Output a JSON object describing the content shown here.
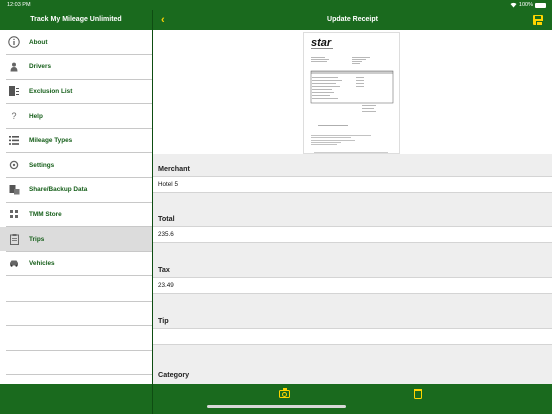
{
  "status_bar": {
    "time": "12:03 PM",
    "battery": "100%"
  },
  "sidebar": {
    "title": "Track My Mileage Unlimited",
    "items": [
      {
        "label": "About",
        "icon": "info-icon"
      },
      {
        "label": "Drivers",
        "icon": "person-icon"
      },
      {
        "label": "Exclusion List",
        "icon": "exclusion-list-icon"
      },
      {
        "label": "Help",
        "icon": "question-icon"
      },
      {
        "label": "Mileage Types",
        "icon": "list-icon"
      },
      {
        "label": "Settings",
        "icon": "gear-icon"
      },
      {
        "label": "Share/Backup Data",
        "icon": "share-backup-icon"
      },
      {
        "label": "TMM Store",
        "icon": "store-icon"
      },
      {
        "label": "Trips",
        "icon": "clipboard-icon",
        "selected": true
      },
      {
        "label": "Vehicles",
        "icon": "car-icon"
      }
    ]
  },
  "header": {
    "title": "Update Receipt"
  },
  "receipt": {
    "brand": "star"
  },
  "form": {
    "merchant": {
      "label": "Merchant",
      "value": "Hotel 5"
    },
    "total": {
      "label": "Total",
      "value": "235.6"
    },
    "tax": {
      "label": "Tax",
      "value": "23.49"
    },
    "tip": {
      "label": "Tip",
      "value": ""
    },
    "category": {
      "label": "Category"
    }
  },
  "colors": {
    "brand_green": "#1a6a1e",
    "accent_yellow": "#ffd400",
    "label_green": "#155e19"
  }
}
